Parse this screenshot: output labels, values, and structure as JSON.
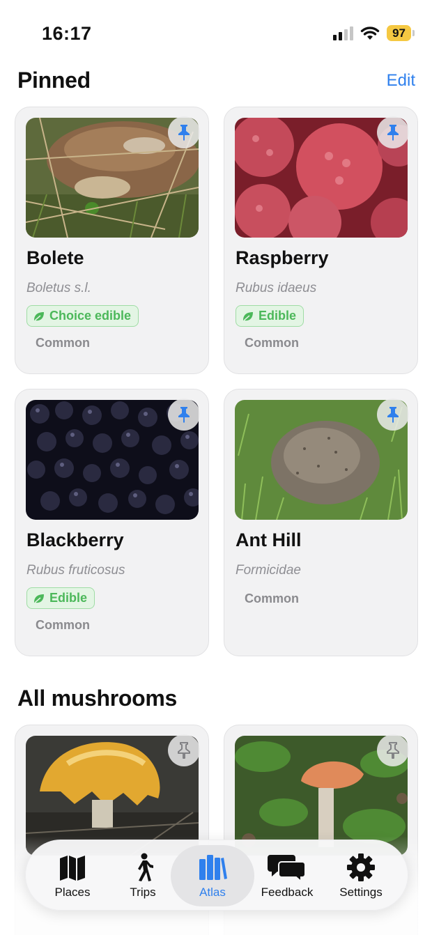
{
  "status_bar": {
    "time": "16:17",
    "battery": "97"
  },
  "pinned": {
    "title": "Pinned",
    "edit_label": "Edit",
    "cards": [
      {
        "name": "Bolete",
        "latin": "Boletus s.l.",
        "badge": "Choice edible",
        "rarity": "Common"
      },
      {
        "name": "Raspberry",
        "latin": "Rubus idaeus",
        "badge": "Edible",
        "rarity": "Common"
      },
      {
        "name": "Blackberry",
        "latin": "Rubus fruticosus",
        "badge": "Edible",
        "rarity": "Common"
      },
      {
        "name": "Ant Hill",
        "latin": "Formicidae",
        "rarity": "Common"
      }
    ]
  },
  "all_mushrooms": {
    "title": "All mushrooms"
  },
  "tab_bar": {
    "tabs": [
      {
        "label": "Places",
        "icon": "map-icon"
      },
      {
        "label": "Trips",
        "icon": "walk-icon"
      },
      {
        "label": "Atlas",
        "icon": "books-icon"
      },
      {
        "label": "Feedback",
        "icon": "chat-bubbles-icon"
      },
      {
        "label": "Settings",
        "icon": "gear-icon"
      }
    ],
    "active": "Atlas"
  },
  "colors": {
    "accent": "#2f80ed",
    "edible_green": "#4cb85a",
    "battery": "#f5c842"
  }
}
